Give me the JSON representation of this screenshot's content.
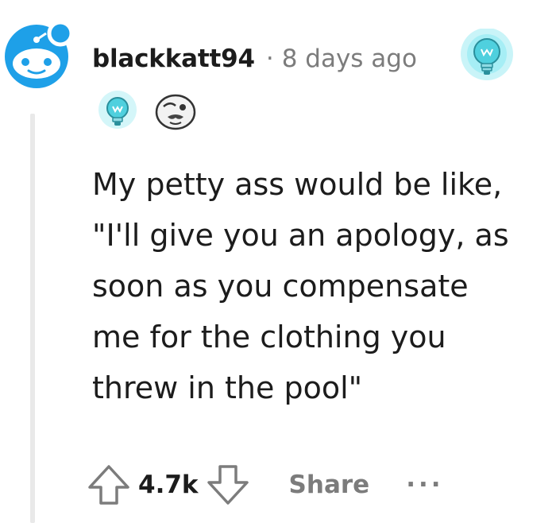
{
  "comment": {
    "author": "blackkatt94",
    "separator": "·",
    "timestamp": "8 days ago",
    "body": "My petty ass would be like,\n\"I'll give you an apology, as\nsoon as you compensate\nme for the clothing you\nthrew in the pool\""
  },
  "awards": {
    "header_award_icon": "lightbulb-award-icon",
    "row": [
      "lightbulb-award-icon",
      "mustache-face-award-icon"
    ]
  },
  "actions": {
    "upvote_icon": "upvote-arrow-icon",
    "score": "4.7k",
    "downvote_icon": "downvote-arrow-icon",
    "share_label": "Share",
    "more_label": "···"
  },
  "colors": {
    "text": "#1c1c1c",
    "meta": "#7c7c7c",
    "avatar_blue": "#1ea0e8",
    "thread_line": "#e9e9e9",
    "award_teal": "#4fd0de"
  }
}
